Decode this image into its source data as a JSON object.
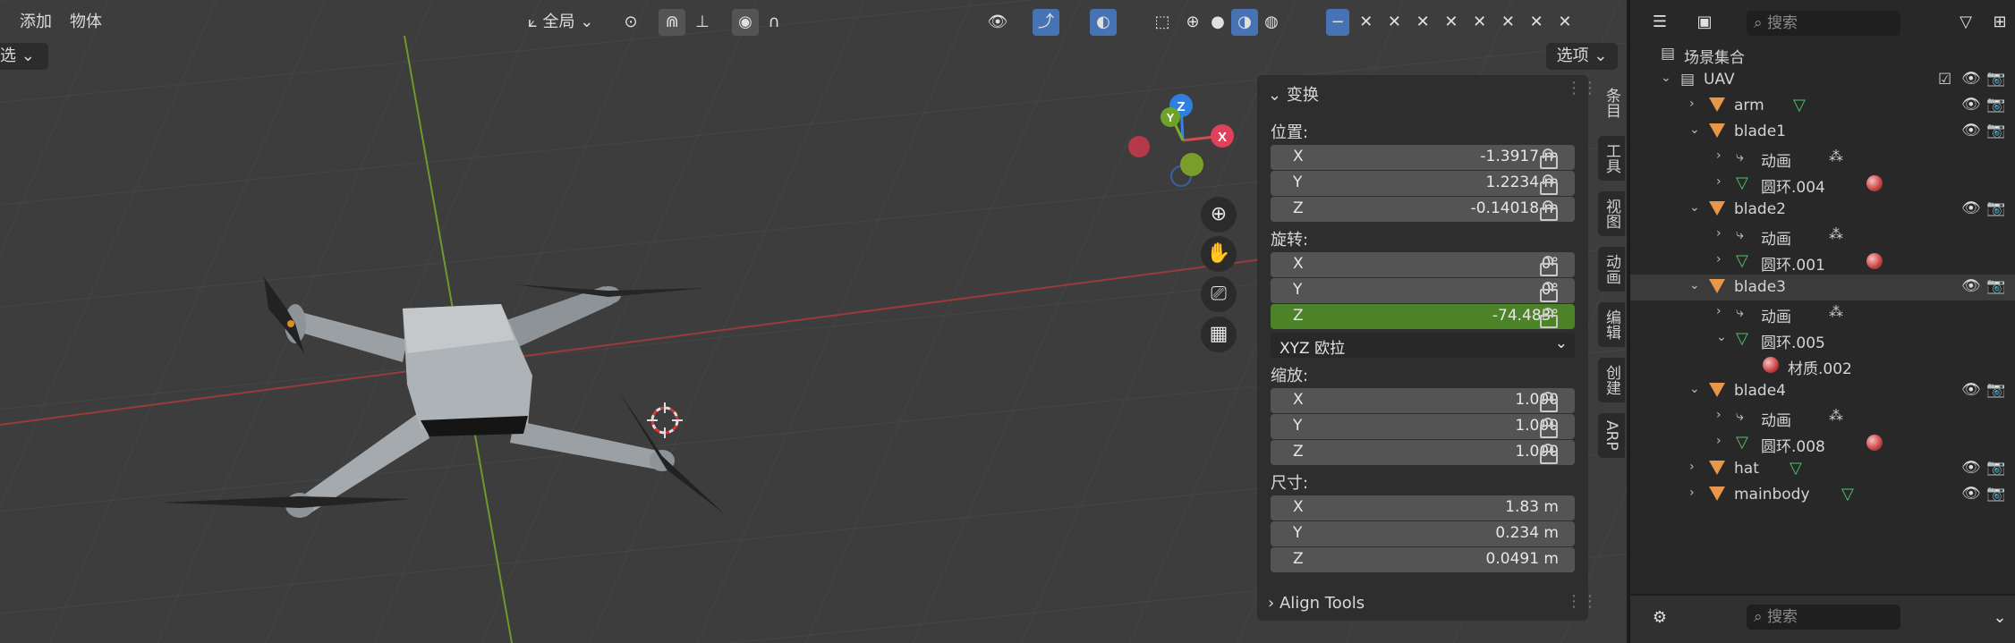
{
  "header": {
    "menu_add": "添加",
    "menu_object": "物体",
    "transform_orientation": "全局",
    "options": "选项",
    "left_cut": "选"
  },
  "gizmo": {
    "x": "X",
    "y": "Y",
    "z": "Z"
  },
  "npanel": {
    "section_transform": "变换",
    "location_label": "位置:",
    "location": {
      "x": "-1.3917 m",
      "y": "1.2234 m",
      "z": "-0.14018 m"
    },
    "rotation_label": "旋转:",
    "rotation": {
      "x": "0°",
      "y": "0°",
      "z": "-74.483°"
    },
    "rotation_mode": "XYZ 欧拉",
    "scale_label": "缩放:",
    "scale": {
      "x": "1.000",
      "y": "1.000",
      "z": "1.000"
    },
    "dimensions_label": "尺寸:",
    "dimensions": {
      "x": "1.83 m",
      "y": "0.234 m",
      "z": "0.0491 m"
    },
    "axis_x": "X",
    "axis_y": "Y",
    "axis_z": "Z",
    "section_align": "Align Tools"
  },
  "tabs": [
    "条目",
    "工具",
    "视图",
    "动画",
    "编辑",
    "创建",
    "ARP"
  ],
  "outliner": {
    "search_placeholder": "搜索",
    "scene_collection": "场景集合",
    "uav": "UAV",
    "arm": "arm",
    "blade1": "blade1",
    "blade1_anim": "动画",
    "blade1_mesh": "圆环.004",
    "blade2": "blade2",
    "blade2_anim": "动画",
    "blade2_mesh": "圆环.001",
    "blade3": "blade3",
    "blade3_anim": "动画",
    "blade3_mesh": "圆环.005",
    "blade3_mat": "材质.002",
    "blade4": "blade4",
    "blade4_anim": "动画",
    "blade4_mesh": "圆环.008",
    "hat": "hat",
    "mainbody": "mainbody"
  },
  "properties": {
    "search_placeholder": "搜索"
  },
  "colors": {
    "viewport": "#3d3d3d",
    "active_field": "#4d8328",
    "accent": "#4772b3",
    "object_icon": "#e8964a",
    "mesh_icon": "#52c466"
  }
}
